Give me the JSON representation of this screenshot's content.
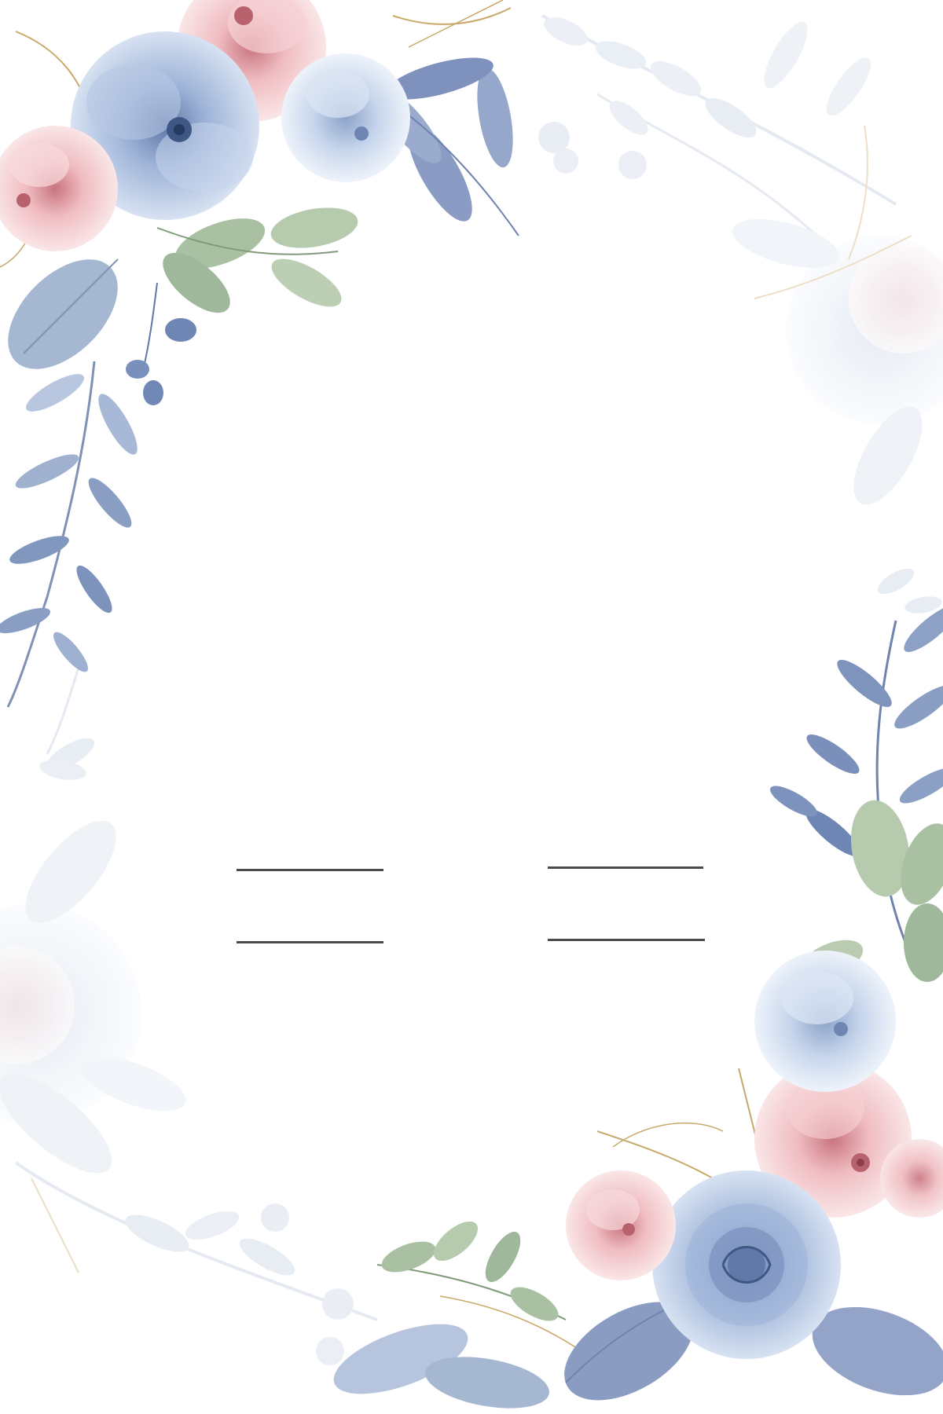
{
  "card": {
    "background": "#ffffff",
    "line_color": "#4a4a4a",
    "palette": {
      "dusty_blue": "#7f95bd",
      "pale_blue": "#c3d3ea",
      "blush_pink": "#eeb9bd",
      "sage_green": "#a8bfa0",
      "gold": "#c9a96a",
      "faded": "#e6ebf3"
    },
    "decorations": [
      "top-left-floral-bouquet",
      "bottom-right-floral-bouquet",
      "top-right-faded-floral",
      "bottom-left-faded-floral"
    ]
  }
}
